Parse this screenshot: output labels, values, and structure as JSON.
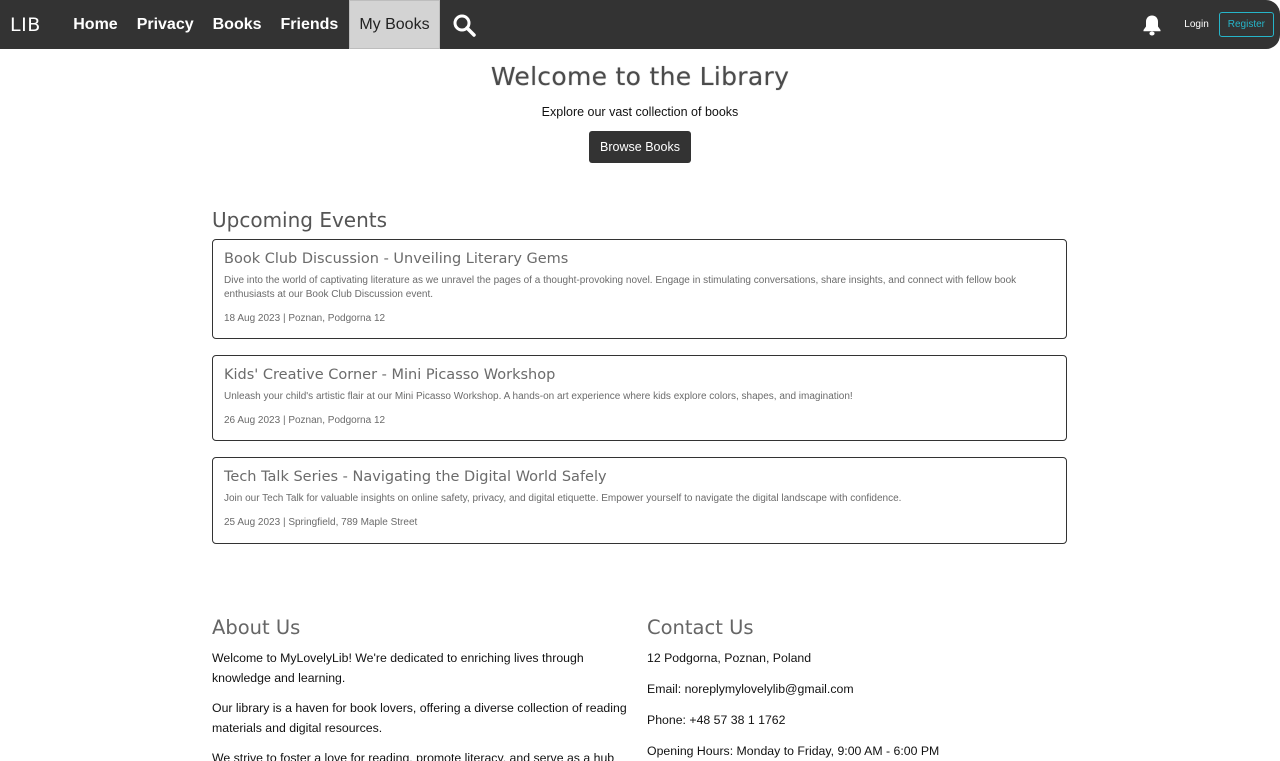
{
  "nav": {
    "brand": "LIB",
    "links": [
      "Home",
      "Privacy",
      "Books",
      "Friends",
      "My Books"
    ],
    "login": "Login",
    "register": "Register",
    "icons": [
      "search-icon",
      "bell-icon"
    ]
  },
  "hero": {
    "title": "Welcome to the Library",
    "subtitle": "Explore our vast collection of books",
    "button": "Browse Books"
  },
  "events": {
    "title": "Upcoming Events",
    "items": [
      {
        "title": "Book Club Discussion - Unveiling Literary Gems",
        "description": "Dive into the world of captivating literature as we unravel the pages of a thought-provoking novel. Engage in stimulating conversations, share insights, and connect with fellow book enthusiasts at our Book Club Discussion event.",
        "meta": "18 Aug 2023 | Poznan, Podgorna 12"
      },
      {
        "title": "Kids' Creative Corner - Mini Picasso Workshop",
        "description": "Unleash your child's artistic flair at our Mini Picasso Workshop. A hands-on art experience where kids explore colors, shapes, and imagination!",
        "meta": "26 Aug 2023 | Poznan, Podgorna 12"
      },
      {
        "title": "Tech Talk Series - Navigating the Digital World Safely",
        "description": "Join our Tech Talk for valuable insights on online safety, privacy, and digital etiquette. Empower yourself to navigate the digital landscape with confidence.",
        "meta": "25 Aug 2023 | Springfield, 789 Maple Street"
      }
    ]
  },
  "about": {
    "title": "About Us",
    "paragraphs": [
      "Welcome to MyLovelyLib! We're dedicated to enriching lives through knowledge and learning.",
      "Our library is a haven for book lovers, offering a diverse collection of reading materials and digital resources.",
      "We strive to foster a love for reading, promote literacy, and serve as a hub for"
    ]
  },
  "contact": {
    "title": "Contact Us",
    "address": "12 Podgorna, Poznan, Poland",
    "email": "Email: noreplymylovelylib@gmail.com",
    "phone": "Phone: +48 57 38 1 1762",
    "hours": "Opening Hours: Monday to Friday, 9:00 AM - 6:00 PM"
  },
  "colors": {
    "navbar": "#333333",
    "active_tab": "#d3d3d3",
    "register_accent": "#26b5c9"
  }
}
